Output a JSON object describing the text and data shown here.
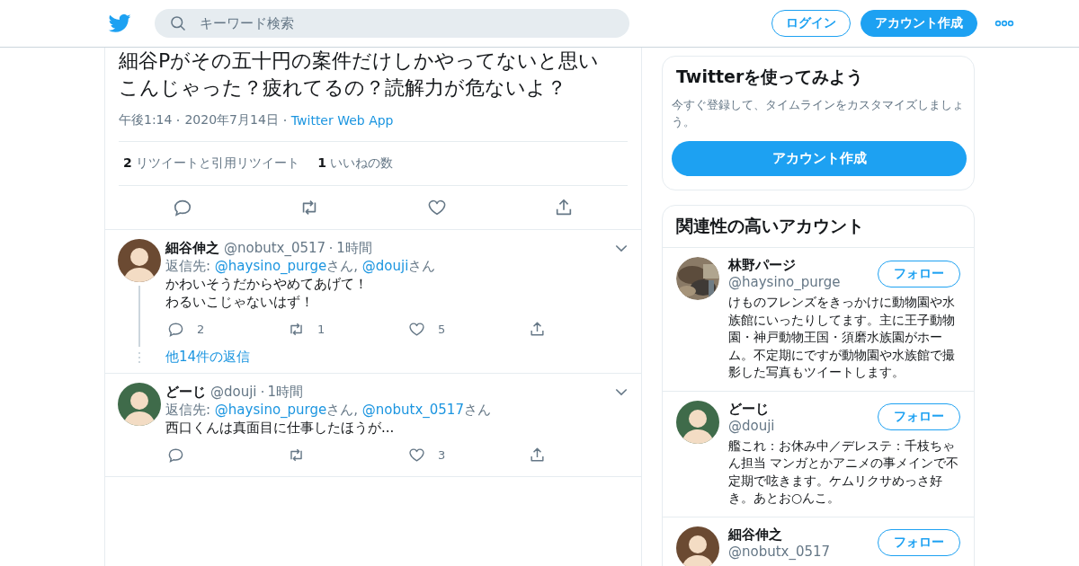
{
  "header": {
    "search": {
      "placeholder": "キーワード検索"
    },
    "buttons": [
      {
        "label": "ログイン",
        "kind": "outline"
      },
      {
        "label": "アカウント作成",
        "kind": "filled"
      }
    ]
  },
  "tweet": {
    "text_lines": [
      "細谷Pがその五十円の案件だけしかやってないと思い",
      "こんじゃった？疲れてるの？読解力が危ないよ？"
    ],
    "time": "午後1:14",
    "date": "2020年7月14日",
    "source": "Twitter Web App",
    "stats": [
      {
        "count": "2",
        "label": "リツイートと引用リツイート"
      },
      {
        "count": "1",
        "label": "いいねの数"
      }
    ],
    "actions": [
      {
        "kind": "reply"
      },
      {
        "kind": "retweet"
      },
      {
        "kind": "like"
      },
      {
        "kind": "share"
      }
    ]
  },
  "replies": [
    {
      "name": "細谷伸之",
      "handle": "@nobutx_0517",
      "time": "1時間",
      "avatar": {
        "kind": "figure",
        "color": "#6b4a32"
      },
      "reply_label": "返信先:",
      "mentions": [
        {
          "handle": "@haysino_purge",
          "suffix": "さん,"
        },
        {
          "handle": "@douji",
          "suffix": "さん"
        }
      ],
      "text_lines": [
        "かわいそうだからやめてあげて！",
        "わるいこじゃないはず！"
      ],
      "actions": [
        {
          "kind": "reply",
          "count": "2"
        },
        {
          "kind": "retweet",
          "count": "1"
        },
        {
          "kind": "like",
          "count": "5"
        },
        {
          "kind": "share"
        }
      ],
      "thread": true,
      "more_replies": "他14件の返信"
    },
    {
      "name": "どーじ",
      "handle": "@douji",
      "time": "1時間",
      "avatar": {
        "kind": "figure",
        "color": "#3f6b4a"
      },
      "reply_label": "返信先:",
      "mentions": [
        {
          "handle": "@haysino_purge",
          "suffix": "さん,"
        },
        {
          "handle": "@nobutx_0517",
          "suffix": "さん"
        }
      ],
      "text_lines": [
        "西口くんは真面目に仕事したほうが..."
      ],
      "actions": [
        {
          "kind": "reply"
        },
        {
          "kind": "retweet"
        },
        {
          "kind": "like",
          "count": "3"
        },
        {
          "kind": "share"
        }
      ],
      "thread": false
    }
  ],
  "signup_card": {
    "title": "Twitterを使ってみよう",
    "description": "今すぐ登録して、タイムラインをカスタマイズしましょう。",
    "button": "アカウント作成"
  },
  "related": {
    "title": "関連性の高いアカウント",
    "accounts": [
      {
        "name": "林野パージ",
        "handle": "@haysino_purge",
        "button": "フォロー",
        "bio": "けものフレンズをきっかけに動物園や水族館にいったりしてます。主に王子動物園・神戸動物王国・須磨水族園がホーム。不定期にですが動物園や水族館で撮影した写真もツイートします。"
      },
      {
        "name": "どーじ",
        "handle": "@douji",
        "avatar": {
          "kind": "figure",
          "color": "#3f6b4a"
        },
        "button": "フォロー",
        "bio": "艦これ：お休み中／デレステ：千枝ちゃん担当 マンガとかアニメの事メインで不定期で呟きます。ケムリクサめっさ好き。あとお○んこ。"
      },
      {
        "name": "細谷伸之",
        "handle": "@nobutx_0517",
        "avatar": {
          "kind": "figure",
          "color": "#6b4a32"
        },
        "button": "フォロー"
      }
    ]
  }
}
